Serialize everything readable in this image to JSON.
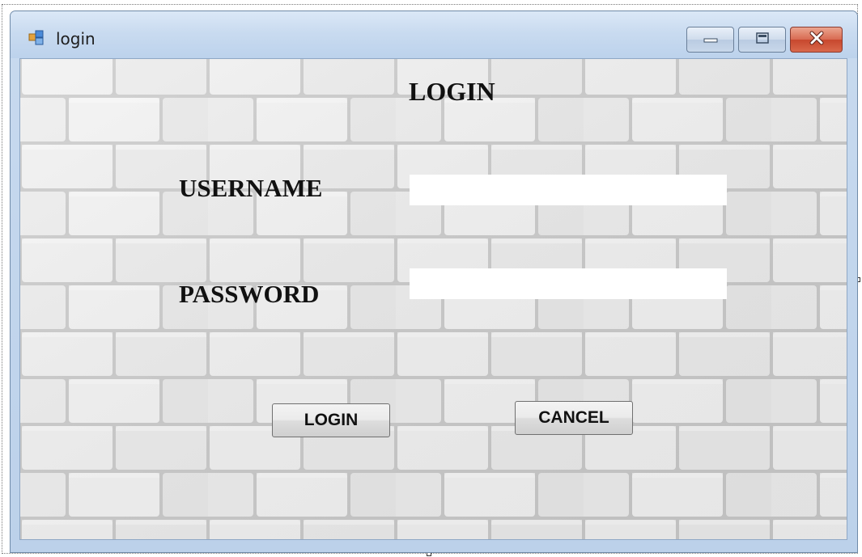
{
  "window": {
    "title": "login",
    "icon": "form-icon",
    "caption_buttons": [
      "minimize-icon",
      "maximize-icon",
      "close-icon"
    ]
  },
  "form": {
    "heading": "LOGIN",
    "username_label": "USERNAME",
    "username_value": "",
    "password_label": "PASSWORD",
    "password_value": "",
    "login_button": "LOGIN",
    "cancel_button": "CANCEL"
  },
  "background": {
    "pattern": "white-brick-wall"
  },
  "colors": {
    "titlebar": "#c9dbf0",
    "close_button": "#c7472d",
    "brick_face": "#efefef",
    "mortar": "#c2c2c2"
  }
}
